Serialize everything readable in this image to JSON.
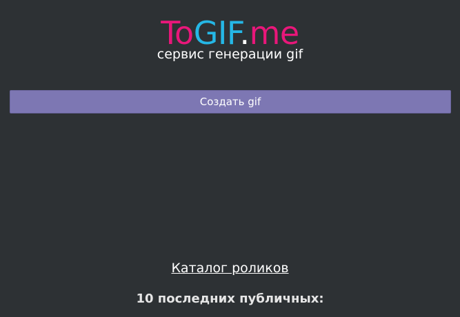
{
  "header": {
    "logo": {
      "part_to": "To",
      "part_gif": "GIF",
      "part_dot": ".",
      "part_me": "me"
    },
    "tagline": "сервис генерации gif"
  },
  "main": {
    "create_button_label": "Создать gif",
    "catalog_link_label": "Каталог роликов",
    "recent_heading": "10 последних публичных:"
  },
  "colors": {
    "background": "#2d3134",
    "logo_pink": "#e8177a",
    "logo_blue": "#25b7e6",
    "button": "#7d77b3",
    "text": "#ffffff"
  }
}
